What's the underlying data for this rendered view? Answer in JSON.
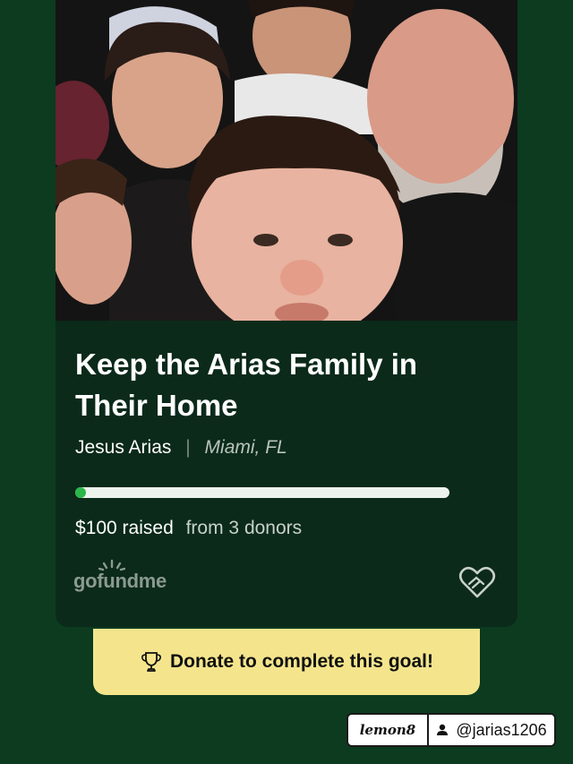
{
  "campaign": {
    "title": "Keep the Arias Family in Their Home",
    "organizer": "Jesus Arias",
    "location": "Miami, FL",
    "raised": "$100 raised",
    "donors": "from 3 donors",
    "progress_fraction": 0.02
  },
  "brand": {
    "logo": "gofundme"
  },
  "cta": {
    "label": "Donate to complete this goal!",
    "icon": "trophy-icon"
  },
  "watermark": {
    "brand": "lemon8",
    "username": "@jarias1206"
  },
  "colors": {
    "background": "#0c3b20",
    "card": "#0b2a1a",
    "progress_fill": "#2bb64a",
    "cta_background": "#f4e58c"
  }
}
